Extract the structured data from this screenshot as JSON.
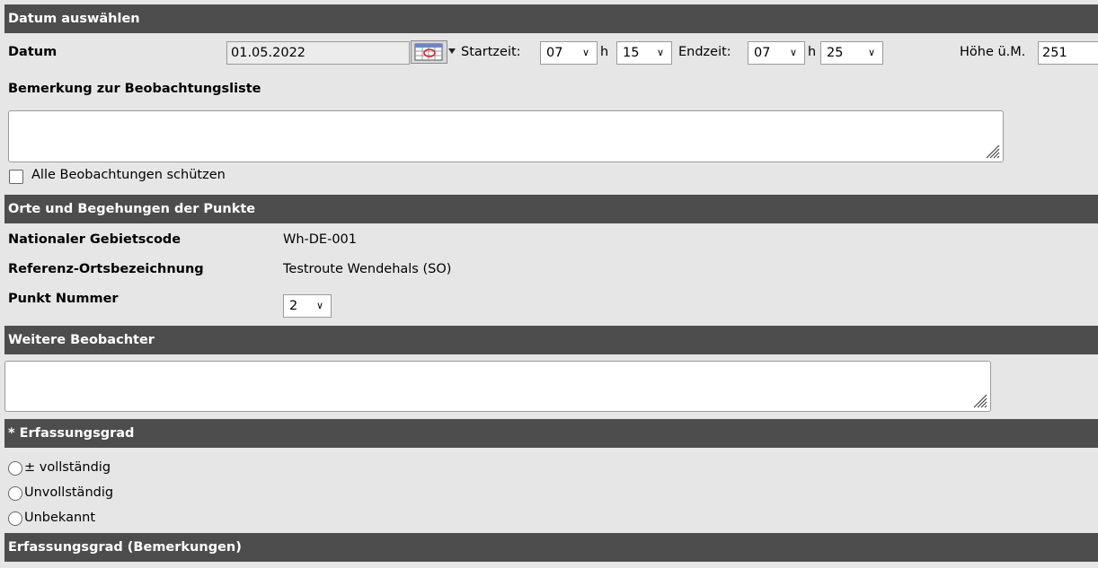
{
  "sections": {
    "datum_header": "Datum auswählen",
    "orte_header": "Orte und Begehungen der Punkte",
    "beobachter_header": "Weitere Beobachter",
    "erfassung_header": "* Erfassungsgrad",
    "erfassung_bem_header": "Erfassungsgrad (Bemerkungen)"
  },
  "datum": {
    "label": "Datum",
    "value": "01.05.2022",
    "calendar_icon": "calendar-icon",
    "startzeit_label": "Startzeit:",
    "start_hour": "07",
    "h1": "h",
    "start_min": "15",
    "endzeit_label": "Endzeit:",
    "end_hour": "07",
    "h2": "h",
    "end_min": "25",
    "hoehe_label": "Höhe ü.M.",
    "hoehe_value": "251"
  },
  "bemerkung": {
    "label": "Bemerkung zur Beobachtungsliste",
    "value": ""
  },
  "schutz": {
    "label": "Alle Beobachtungen schützen",
    "checked": false
  },
  "orte": {
    "gebietscode_label": "Nationaler Gebietscode",
    "gebietscode_value": "Wh-DE-001",
    "referenz_label": "Referenz-Ortsbezeichnung",
    "referenz_value": "Testroute Wendehals (SO)",
    "punkt_label": "Punkt Nummer",
    "punkt_value": "2"
  },
  "beobachter": {
    "value": ""
  },
  "erfassungsgrad": {
    "options": [
      "± vollständig",
      "Unvollständig",
      "Unbekannt"
    ]
  },
  "colors": {
    "header_bg": "#4d4d4d",
    "page_bg": "#e6e6e6"
  }
}
